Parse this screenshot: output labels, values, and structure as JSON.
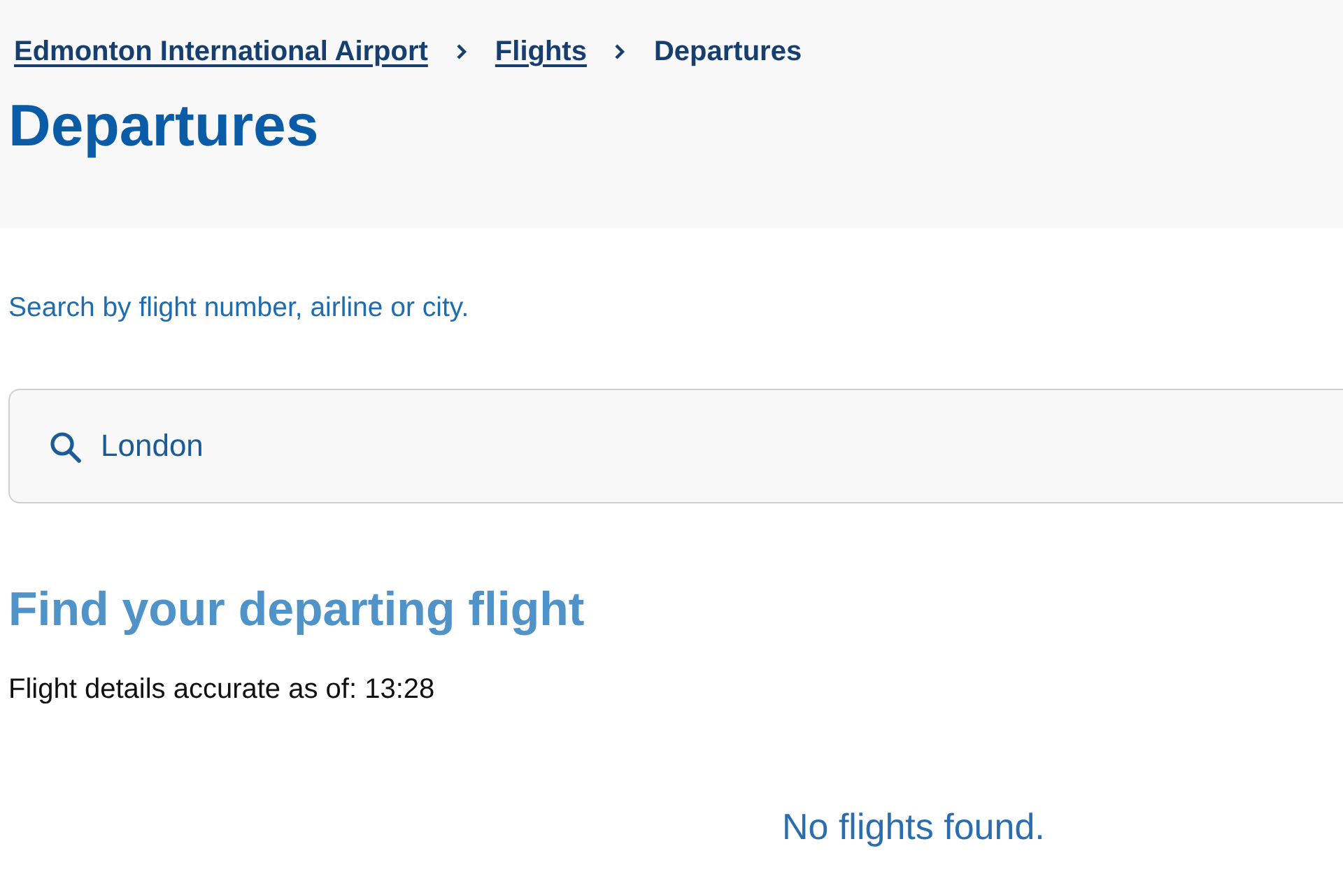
{
  "breadcrumb": [
    {
      "label": "Edmonton International Airport",
      "kind": "link"
    },
    {
      "label": "Flights",
      "kind": "link"
    },
    {
      "label": "Departures",
      "kind": "current"
    }
  ],
  "page_title": "Departures",
  "search": {
    "instructions": "Search by flight number, airline or city.",
    "value": "London"
  },
  "results": {
    "heading": "Find your departing flight",
    "timestamp": "Flight details accurate as of: 13:28",
    "empty_message": "No flights found."
  }
}
